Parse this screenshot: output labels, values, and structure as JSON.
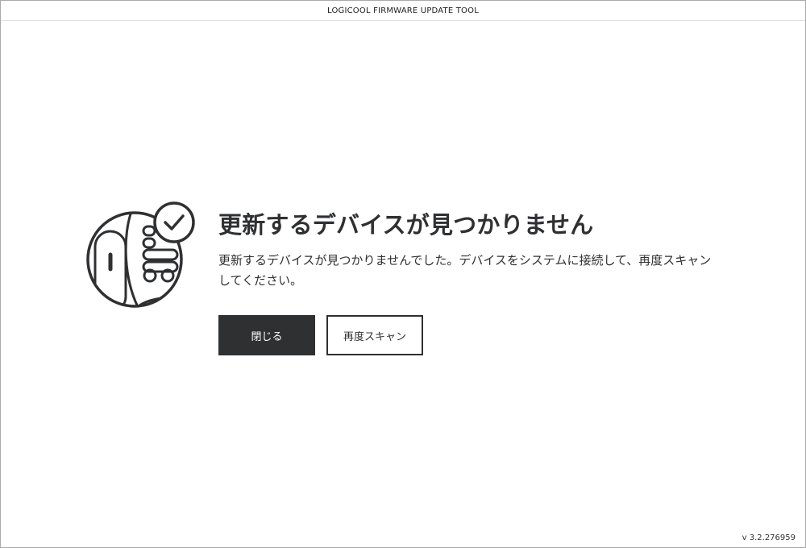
{
  "window": {
    "title": "LOGICOOL FIRMWARE UPDATE TOOL"
  },
  "illustration": {
    "icon": "devices-with-checkmark-icon"
  },
  "message": {
    "heading": "更新するデバイスが見つかりません",
    "description": "更新するデバイスが見つかりませんでした。デバイスをシステムに接続して、再度スキャンしてください。"
  },
  "actions": {
    "close_label": "閉じる",
    "rescan_label": "再度スキャン"
  },
  "footer": {
    "version": "v 3.2.276959"
  },
  "colors": {
    "dark": "#2f3032",
    "background": "#ffffff",
    "border": "#a9a9a9"
  }
}
